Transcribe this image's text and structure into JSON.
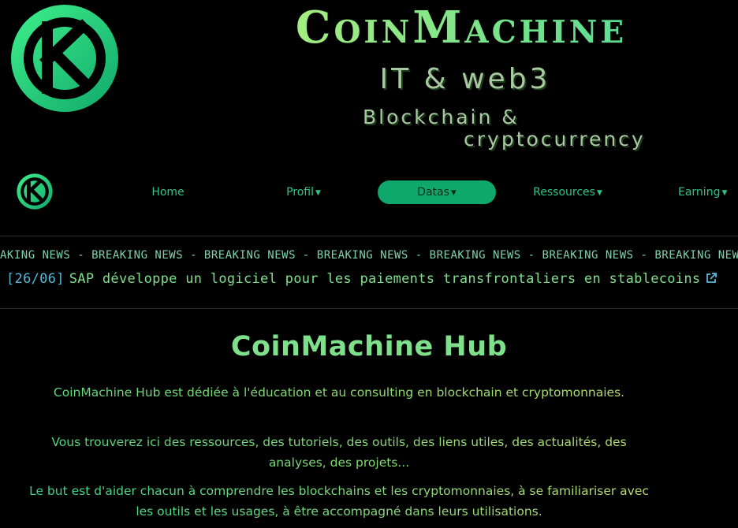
{
  "brand": {
    "title": "CoinMachine",
    "subtitle_line1": "IT & web3",
    "subtitle_line2": "Blockchain &",
    "subtitle_line3": "cryptocurrency"
  },
  "nav": {
    "items": [
      {
        "label": "Home",
        "dropdown": false
      },
      {
        "label": "Profil",
        "dropdown": true
      },
      {
        "label": "Datas",
        "dropdown": true,
        "active": true
      },
      {
        "label": "Ressources",
        "dropdown": true
      },
      {
        "label": "Earning",
        "dropdown": true
      }
    ]
  },
  "ticker": {
    "breaking_text": "AKING NEWS - BREAKING NEWS - BREAKING NEWS - BREAKING NEWS - BREAKING NEWS - BREAKING NEWS - BREAKING NEWS -",
    "news": {
      "date": "[26/06]",
      "title": "SAP développe un logiciel pour les paiements transfrontaliers en stablecoins"
    }
  },
  "main": {
    "title": "CoinMachine Hub",
    "paragraphs": [
      "CoinMachine Hub est dédiée à l'éducation et au consulting en blockchain et cryptomonnaies.",
      "Vous trouverez ici des ressources, des tutoriels, des outils, des liens utiles, des actualités, des analyses, des projets...",
      "Le but est d'aider chacun à comprendre les blockchains et les cryptomonnaies, à se familiariser avec les outils et les usages, à être accompagné dans leurs utilisations."
    ]
  },
  "colors": {
    "accent": "#0fa86b",
    "text_green": "#7ee08a",
    "nav_text": "#2fc38a",
    "date_blue": "#56b8d8"
  },
  "icons": {
    "logo": "ck-logo-icon",
    "external_link": "external-link-icon",
    "dropdown": "caret-down-icon"
  }
}
